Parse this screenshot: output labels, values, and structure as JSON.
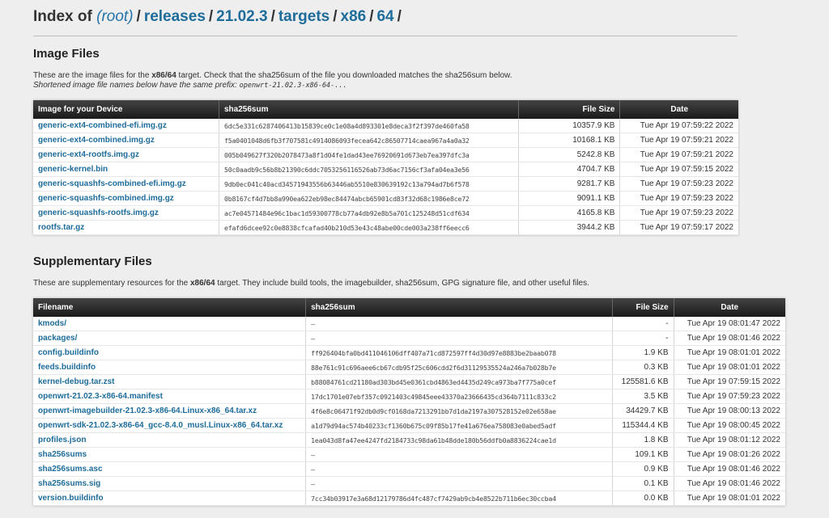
{
  "breadcrumb": {
    "prefix": "Index of",
    "root": "(root)",
    "parts": [
      "releases",
      "21.02.3",
      "targets",
      "x86",
      "64"
    ],
    "trailing": "/"
  },
  "image_files": {
    "title": "Image Files",
    "desc_1a": "These are the image files for the ",
    "desc_1b": "x86/64",
    "desc_1c": " target. Check that the sha256sum of the file you downloaded matches the sha256sum below.",
    "desc_2a": "Shortened image file names below have the same prefix: ",
    "desc_2b": "openwrt-21.02.3-x86-64-...",
    "headers": [
      "Image for your Device",
      "sha256sum",
      "File Size",
      "Date"
    ],
    "rows": [
      {
        "name": "generic-ext4-combined-efi.img.gz",
        "sha": "6dc5e331c6287406413b15839ce0c1e08a4d893301e8deca3f2f397de460fa58",
        "size": "10357.9 KB",
        "date": "Tue Apr 19 07:59:22 2022"
      },
      {
        "name": "generic-ext4-combined.img.gz",
        "sha": "f5a0401048d6fb3f707581c4914086093fecea642c86507714caea967a4a0a32",
        "size": "10168.1 KB",
        "date": "Tue Apr 19 07:59:21 2022"
      },
      {
        "name": "generic-ext4-rootfs.img.gz",
        "sha": "005b049627f320b2078473a8f1d04fe1dad43ee76920691d673eb7ea397dfc3a",
        "size": "5242.8 KB",
        "date": "Tue Apr 19 07:59:21 2022"
      },
      {
        "name": "generic-kernel.bin",
        "sha": "50c0aadb9c56b8b21390c6ddc7053256116526ab73d6ac7156cf3afa04ea3e56",
        "size": "4704.7 KB",
        "date": "Tue Apr 19 07:59:15 2022"
      },
      {
        "name": "generic-squashfs-combined-efi.img.gz",
        "sha": "9db0ec041c40acd34571943556b63446ab5510e830639192c13a794ad7b6f578",
        "size": "9281.7 KB",
        "date": "Tue Apr 19 07:59:23 2022"
      },
      {
        "name": "generic-squashfs-combined.img.gz",
        "sha": "0b8167cf4d7bb8a990ea622eb98ec84474abcb65901cd83f32d68c1986e8ce72",
        "size": "9091.1 KB",
        "date": "Tue Apr 19 07:59:23 2022"
      },
      {
        "name": "generic-squashfs-rootfs.img.gz",
        "sha": "ac7e04571484e96c1bac1d59300778cb77a4db92e8b5a701c125248d51cdf634",
        "size": "4165.8 KB",
        "date": "Tue Apr 19 07:59:23 2022"
      },
      {
        "name": "rootfs.tar.gz",
        "sha": "efafd6dcee92c0e8838cfcafad40b210d53e43c48abe00cde003a238ff6eecc6",
        "size": "3944.2 KB",
        "date": "Tue Apr 19 07:59:17 2022"
      }
    ]
  },
  "supplementary": {
    "title": "Supplementary Files",
    "desc_a": "These are supplementary resources for the ",
    "desc_b": "x86/64",
    "desc_c": " target. They include build tools, the imagebuilder, sha256sum, GPG signature file, and other useful files.",
    "headers": [
      "Filename",
      "sha256sum",
      "File Size",
      "Date"
    ],
    "rows": [
      {
        "name": "kmods/",
        "sha": "–",
        "size": "-",
        "date": "Tue Apr 19 08:01:47 2022"
      },
      {
        "name": "packages/",
        "sha": "–",
        "size": "-",
        "date": "Tue Apr 19 08:01:46 2022"
      },
      {
        "name": "config.buildinfo",
        "sha": "ff926404bfa0bd411046106dff407a71cd872597ff4d30d97e8883be2baab078",
        "size": "1.9 KB",
        "date": "Tue Apr 19 08:01:01 2022"
      },
      {
        "name": "feeds.buildinfo",
        "sha": "88e761c91c696aee6cb67cdb95f25c606cdd2f6d31129535524a246a7b028b7e",
        "size": "0.3 KB",
        "date": "Tue Apr 19 08:01:01 2022"
      },
      {
        "name": "kernel-debug.tar.zst",
        "sha": "b88084761cd21180ad303bd45e0361cbd4863ed4435d249ca973ba7f775a0cef",
        "size": "125581.6 KB",
        "date": "Tue Apr 19 07:59:15 2022"
      },
      {
        "name": "openwrt-21.02.3-x86-64.manifest",
        "sha": "17dc1701e07ebf357c0921403c49845eee43370a23666435cd364b7111c833c2",
        "size": "3.5 KB",
        "date": "Tue Apr 19 07:59:23 2022"
      },
      {
        "name": "openwrt-imagebuilder-21.02.3-x86-64.Linux-x86_64.tar.xz",
        "sha": "4f6e8c06471f92db0d9cf0168da7213291bb7d1da2197a307528152e02e658ae",
        "size": "34429.7 KB",
        "date": "Tue Apr 19 08:00:13 2022"
      },
      {
        "name": "openwrt-sdk-21.02.3-x86-64_gcc-8.4.0_musl.Linux-x86_64.tar.xz",
        "sha": "a1d79d94ac574b40233cf1360b675c09f85b17fe41a676ea758083e0abed5adf",
        "size": "115344.4 KB",
        "date": "Tue Apr 19 08:00:45 2022"
      },
      {
        "name": "profiles.json",
        "sha": "1ea043d8fa47ee4247fd2184733c98da61b48dde180b56ddfb0a8836224cae1d",
        "size": "1.8 KB",
        "date": "Tue Apr 19 08:01:12 2022"
      },
      {
        "name": "sha256sums",
        "sha": "–",
        "size": "109.1 KB",
        "date": "Tue Apr 19 08:01:26 2022"
      },
      {
        "name": "sha256sums.asc",
        "sha": "–",
        "size": "0.9 KB",
        "date": "Tue Apr 19 08:01:46 2022"
      },
      {
        "name": "sha256sums.sig",
        "sha": "–",
        "size": "0.1 KB",
        "date": "Tue Apr 19 08:01:46 2022"
      },
      {
        "name": "version.buildinfo",
        "sha": "7cc34b03917e3a68d12179786d4fc487cf7429ab9cb4e8522b711b6ec30ccba4",
        "size": "0.0 KB",
        "date": "Tue Apr 19 08:01:01 2022"
      }
    ]
  }
}
